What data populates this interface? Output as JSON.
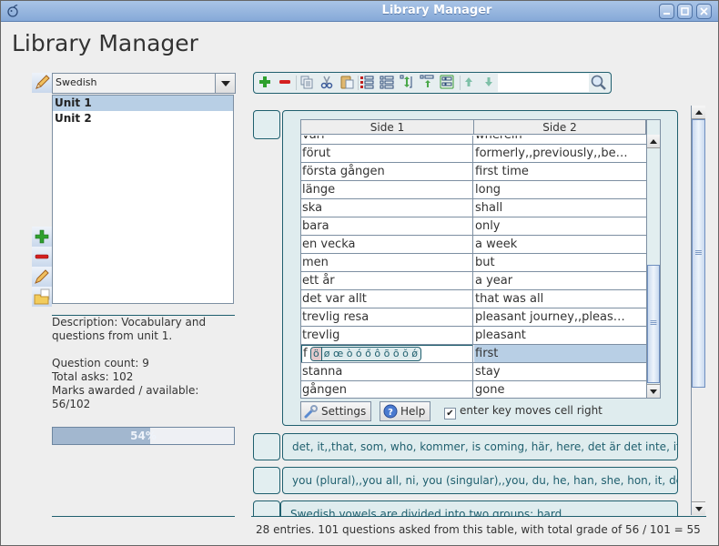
{
  "window": {
    "title": "Library Manager",
    "controls": {
      "minimize": "minimize-icon",
      "maximize": "maximize-icon",
      "close": "close-icon"
    }
  },
  "heading": "Library Manager",
  "library": {
    "selected": "Swedish",
    "units": [
      {
        "label": "Unit 1",
        "selected": true
      },
      {
        "label": "Unit 2",
        "selected": false
      }
    ],
    "side_tools": [
      "add-icon",
      "remove-icon",
      "edit-icon",
      "open-folder-icon"
    ]
  },
  "info": {
    "description": "Description: Vocabulary and questions from unit 1.",
    "question_count": "Question count: 9",
    "total_asks": "Total asks: 102",
    "marks_label": "Marks awarded / available:",
    "marks_value": "56/102",
    "progress_percent": 54,
    "progress_text": "54%"
  },
  "toolbar": {
    "buttons": [
      "add-icon",
      "remove-icon",
      "copy-icon",
      "cut-icon",
      "paste-icon",
      "list-bullets-icon",
      "list-icon",
      "resize-vertical-icon",
      "move-top-icon",
      "table-icon",
      "arrow-up-icon",
      "arrow-down-icon"
    ],
    "search_value": "",
    "search_icon": "search-icon"
  },
  "table": {
    "columns": [
      "Side 1",
      "Side 2"
    ],
    "rows": [
      {
        "side1": "vari",
        "side2": "wherein"
      },
      {
        "side1": "förut",
        "side2": "formerly,,previously,,be…"
      },
      {
        "side1": "första gången",
        "side2": "first time"
      },
      {
        "side1": "länge",
        "side2": "long"
      },
      {
        "side1": "ska",
        "side2": "shall"
      },
      {
        "side1": "bara",
        "side2": "only"
      },
      {
        "side1": "en vecka",
        "side2": "a week"
      },
      {
        "side1": "men",
        "side2": "but"
      },
      {
        "side1": "ett år",
        "side2": "a year"
      },
      {
        "side1": "det var allt",
        "side2": "that was all"
      },
      {
        "side1": "trevlig resa",
        "side2": "pleasant journey,,pleas…"
      },
      {
        "side1": "trevlig",
        "side2": "pleasant"
      },
      {
        "side1": "f",
        "side2": "first",
        "editing": true
      },
      {
        "side1": "stanna",
        "side2": "stay"
      },
      {
        "side1": "gången",
        "side2": "gone"
      }
    ],
    "editor": {
      "prefix": "f",
      "char_highlight": "ö",
      "char_options": "ø œ ò ó ő ô õ ō ŏ ǿ"
    }
  },
  "table_controls": {
    "settings_label": "Settings",
    "help_label": "Help",
    "enter_moves_right_label": "enter key moves cell right",
    "enter_moves_right_checked": true
  },
  "entries": [
    {
      "text": "det, it,,that, som, who, kommer, is coming, här, here, det är det inte, it"
    },
    {
      "text": "you (plural),,you all, ni, you (singular),,you, du, he, han, she, hon, it, de"
    },
    {
      "text": "Swedish vowels are divided into two groups: hard"
    }
  ],
  "status": "28 entries. 101 questions asked from this table, with total grade of 56 / 101 = 55",
  "colors": {
    "accent": "#1f5f6e",
    "selection": "#b8cfe5",
    "titlebar": "#86a9d8",
    "card_bg": "#dfecee"
  }
}
